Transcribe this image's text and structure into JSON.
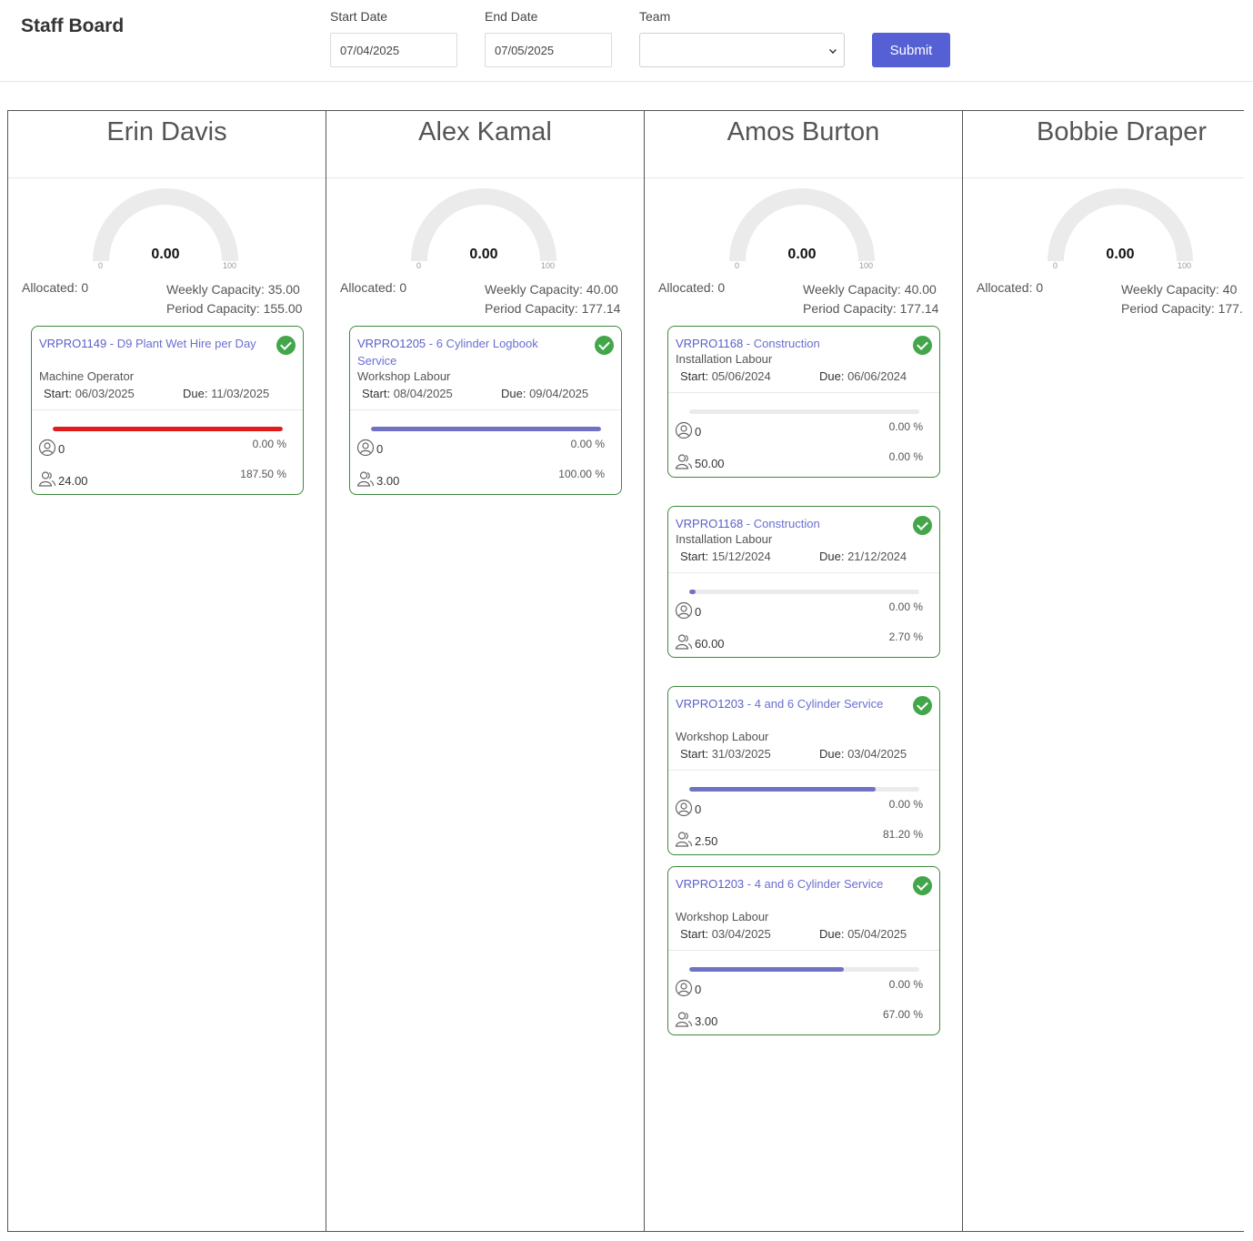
{
  "app": {
    "title": "Staff Board"
  },
  "filters": {
    "start_label": "Start Date",
    "start_value": "07/04/2025",
    "end_label": "End Date",
    "end_value": "07/05/2025",
    "team_label": "Team",
    "team_value": "",
    "submit_label": "Submit"
  },
  "colors": {
    "accent": "#5560d4",
    "progress": "#7171c6",
    "over_capacity": "#e11c1c",
    "card_border": "#3c8a3c",
    "status_ok": "#43a64a",
    "gauge_track": "#ebebeb"
  },
  "icons": {
    "status": "check-circle-icon",
    "allocated": "user-circle-icon",
    "hours": "users-icon"
  },
  "staff": [
    {
      "name": "Erin Davis",
      "gauge": {
        "value": "0.00",
        "min": "0",
        "max": "100",
        "level": 0
      },
      "allocated": "Allocated: 0",
      "weekly_capacity": "Weekly Capacity: 35.00",
      "period_capacity": "Period Capacity: 155.00",
      "jobs": [
        {
          "code": "VRPRO1149",
          "title": " - D9 Plant Wet Hire per Day",
          "role": "Machine Operator",
          "start_label": "Start:",
          "start": " 06/03/2025",
          "due_label": "Due:",
          "due": " 11/03/2025",
          "progress": 100,
          "over": true,
          "allocated": "0",
          "allocated_pct": "0.00 %",
          "hours": "24.00",
          "hours_pct": "187.50 %"
        }
      ]
    },
    {
      "name": "Alex Kamal",
      "gauge": {
        "value": "0.00",
        "min": "0",
        "max": "100",
        "level": 0
      },
      "allocated": "Allocated: 0",
      "weekly_capacity": "Weekly Capacity: 40.00",
      "period_capacity": "Period Capacity: 177.14",
      "jobs": [
        {
          "code": "VRPRO1205",
          "title": " - 6 Cylinder Logbook Service",
          "role": "Workshop Labour",
          "start_label": "Start:",
          "start": " 08/04/2025",
          "due_label": "Due:",
          "due": " 09/04/2025",
          "progress": 100,
          "over": false,
          "allocated": "0",
          "allocated_pct": "0.00 %",
          "hours": "3.00",
          "hours_pct": "100.00 %"
        }
      ]
    },
    {
      "name": "Amos Burton",
      "gauge": {
        "value": "0.00",
        "min": "0",
        "max": "100",
        "level": 0
      },
      "allocated": "Allocated: 0",
      "weekly_capacity": "Weekly Capacity: 40.00",
      "period_capacity": "Period Capacity: 177.14",
      "jobs": [
        {
          "code": "VRPRO1168",
          "title": " - Construction",
          "role": "Installation Labour",
          "start_label": "Start:",
          "start": " 05/06/2024",
          "due_label": "Due:",
          "due": " 06/06/2024",
          "progress": 0,
          "over": false,
          "allocated": "0",
          "allocated_pct": "0.00 %",
          "hours": "50.00",
          "hours_pct": "0.00 %"
        },
        {
          "code": "VRPRO1168",
          "title": " - Construction",
          "role": "Installation Labour",
          "start_label": "Start:",
          "start": " 15/12/2024",
          "due_label": "Due:",
          "due": " 21/12/2024",
          "progress": 2.7,
          "over": false,
          "allocated": "0",
          "allocated_pct": "0.00 %",
          "hours": "60.00",
          "hours_pct": "2.70 %"
        },
        {
          "code": "VRPRO1203",
          "title": " - 4 and 6 Cylinder Service",
          "role": "Workshop Labour",
          "start_label": "Start:",
          "start": " 31/03/2025",
          "due_label": "Due:",
          "due": " 03/04/2025",
          "progress": 81.2,
          "over": false,
          "allocated": "0",
          "allocated_pct": "0.00 %",
          "hours": "2.50",
          "hours_pct": "81.20 %"
        },
        {
          "code": "VRPRO1203",
          "title": " - 4 and 6 Cylinder Service",
          "role": "Workshop Labour",
          "start_label": "Start:",
          "start": " 03/04/2025",
          "due_label": "Due:",
          "due": " 05/04/2025",
          "progress": 67,
          "over": false,
          "allocated": "0",
          "allocated_pct": "0.00 %",
          "hours": "3.00",
          "hours_pct": "67.00 %"
        }
      ]
    },
    {
      "name": "Bobbie Draper",
      "gauge": {
        "value": "0.00",
        "min": "0",
        "max": "100",
        "level": 0
      },
      "allocated": "Allocated: 0",
      "weekly_capacity": "Weekly Capacity: 40",
      "period_capacity": "Period Capacity: 177.",
      "jobs": []
    }
  ]
}
